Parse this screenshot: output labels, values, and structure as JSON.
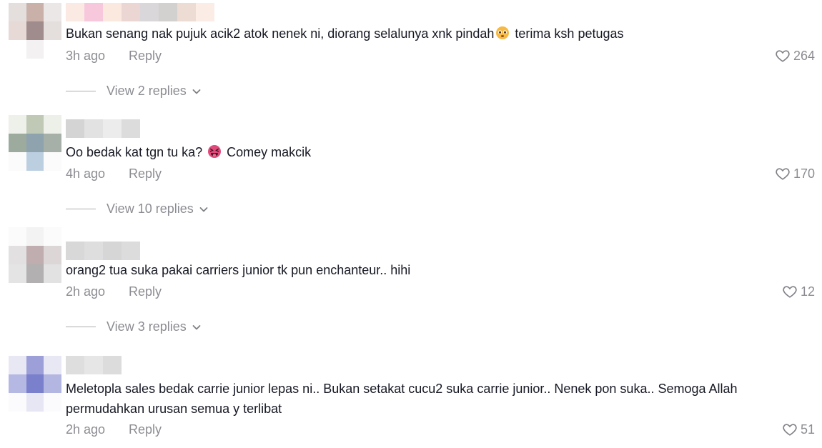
{
  "comments": [
    {
      "text_before": "Bukan senang nak pujuk acik2 atok nenek ni, diorang selalunya xnk pindah",
      "emoji": "pleading-face-emoji",
      "text_after": " terima ksh petugas",
      "time": "3h ago",
      "reply_label": "Reply",
      "likes": "264",
      "view_replies": "View 2 replies"
    },
    {
      "text_before": "Oo bedak kat tgn tu ka? ",
      "emoji": "squinting-tongue-emoji",
      "text_after": " Comey makcik",
      "time": "4h ago",
      "reply_label": "Reply",
      "likes": "170",
      "view_replies": "View 10 replies"
    },
    {
      "text": "orang2 tua suka pakai carriers junior tk pun enchanteur.. hihi",
      "time": "2h ago",
      "reply_label": "Reply",
      "likes": "12",
      "view_replies": "View 3 replies"
    },
    {
      "text": "Meletopla sales bedak carrie junior lepas ni.. Bukan setakat cucu2 suka carrie junior.. Nenek pon suka.. Semoga Allah permudahkan urusan semua y terlibat",
      "time": "2h ago",
      "reply_label": "Reply",
      "likes": "51"
    }
  ],
  "colors": {
    "text": "#161823",
    "muted": "rgba(22,24,35,0.5)"
  }
}
